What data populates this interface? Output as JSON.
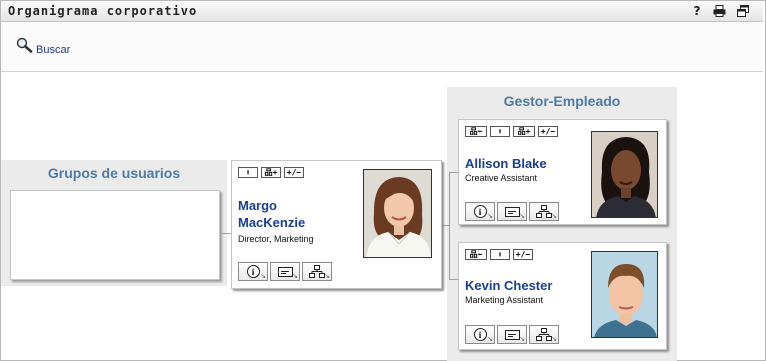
{
  "window": {
    "title": "Organigrama corporativo",
    "help_icon": "?",
    "print_icon": "printer-icon",
    "maximize_icon": "restore-window-icon"
  },
  "toolbar": {
    "search_label": "Buscar",
    "search_icon": "magnifier-icon"
  },
  "groups_panel": {
    "title": "Grupos de usuarios"
  },
  "manager_panel": {
    "title": "Gestor-Empleado"
  },
  "action_buttons": {
    "up": "⬆",
    "expand": "品+",
    "toggle": "+/−",
    "back": "品⬅"
  },
  "person_buttons": {
    "info": "i",
    "corner": "↘"
  },
  "people": [
    {
      "name_line1": "Margo",
      "name_line2": "MacKenzie",
      "title": "Director, Marketing"
    },
    {
      "name": "Allison Blake",
      "title": "Creative Assistant"
    },
    {
      "name": "Kevin Chester",
      "title": "Marketing Assistant"
    }
  ],
  "colors": {
    "panel_title": "#4f7ba6",
    "name_link": "#1b3f8f",
    "panel_bg": "#ebebeb"
  }
}
